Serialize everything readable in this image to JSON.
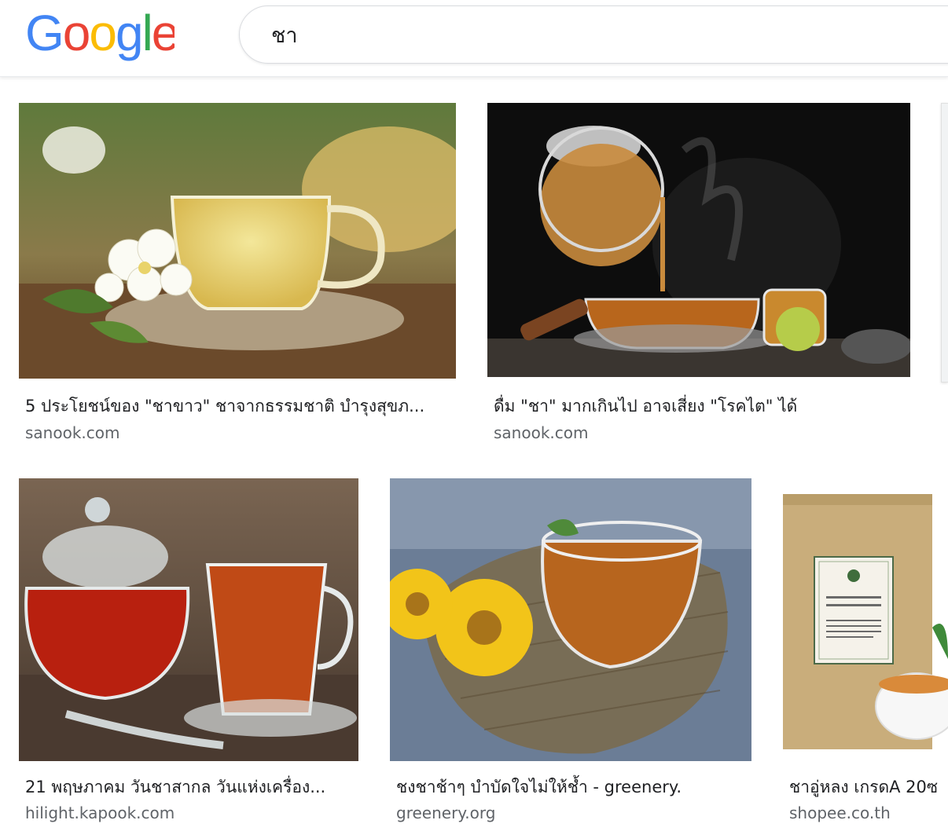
{
  "header": {
    "logo_text": "Google",
    "search_query": "ชา"
  },
  "results": [
    {
      "title": "5 ประโยชน์ของ \"ชาขาว\" ชาจากธรรมชาติ บำรุงสุขภ...",
      "domain": "sanook.com",
      "image": "jasmine-white-tea-cup"
    },
    {
      "title": "ดื่ม \"ชา\" มากเกินไป อาจเสี่ยง \"โรคไต\" ได้",
      "domain": "sanook.com",
      "image": "teapot-pouring-tea"
    },
    {
      "title": "21 พฤษภาคม วันชาสากล วันแห่งเครื่อง...",
      "domain": "hilight.kapook.com",
      "image": "glass-teapot-red-tea"
    },
    {
      "title": "ชงชาช้าๆ บำบัดใจไม่ให้ช้ำ - greenery.",
      "domain": "greenery.org",
      "image": "tea-cup-yellow-flowers"
    },
    {
      "title": "ชาอู่หลง เกรดA 20ซ",
      "domain": "shopee.co.th",
      "image": "oolong-tea-bag-package"
    }
  ],
  "colors": {
    "google_blue": "#4285F4",
    "google_red": "#EA4335",
    "google_yellow": "#FBBC05",
    "google_green": "#34A853",
    "domain_gray": "#5f6368"
  }
}
